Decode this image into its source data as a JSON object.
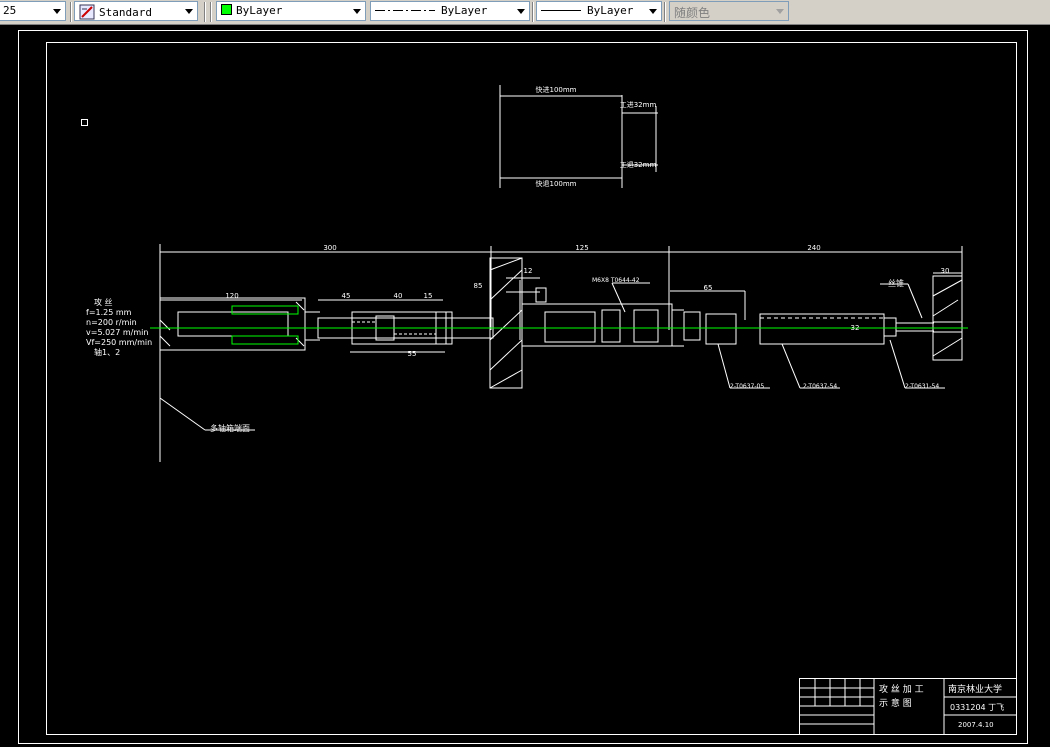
{
  "toolbar": {
    "text_style_value": "25",
    "dim_style_value": "Standard",
    "layer_value": "ByLayer",
    "linetype_value": "ByLayer",
    "lineweight_value": "ByLayer",
    "color_value": "随颜色",
    "accent_color": "#00ff00"
  },
  "drawing": {
    "motion": {
      "fast_forward": "快进100mm",
      "work_forward": "工进32mm",
      "work_back": "工退32mm",
      "fast_back": "快退100mm"
    },
    "dims": {
      "d300": "300",
      "d125": "125",
      "d240": "240",
      "d120": "120",
      "d45": "45",
      "d40": "40",
      "d15": "15",
      "d55": "55",
      "d65": "65",
      "d30": "30",
      "d12": "12",
      "d85": "85",
      "d32": "32"
    },
    "notes": {
      "title": "攻  丝",
      "feed": "f=1.25 mm",
      "speed": "n=200 r/min",
      "cut_speed": "v=5.027 m/min",
      "feed_rate": "Vf=250 mm/min",
      "spindle": "轴1、2",
      "head_section": "多轴箱端面",
      "tap": "丝锥",
      "part1": "M6X8  T0644-42",
      "part2": "2-T0637-05",
      "part3": "2-T0637-54",
      "part4": "2-T0631-54"
    },
    "title_block": {
      "title_line1": "攻  丝  加  工",
      "title_line2": "示  意  图",
      "school": "南京林业大学",
      "student": "0331204  丁飞",
      "date": "2007.4.10"
    }
  }
}
